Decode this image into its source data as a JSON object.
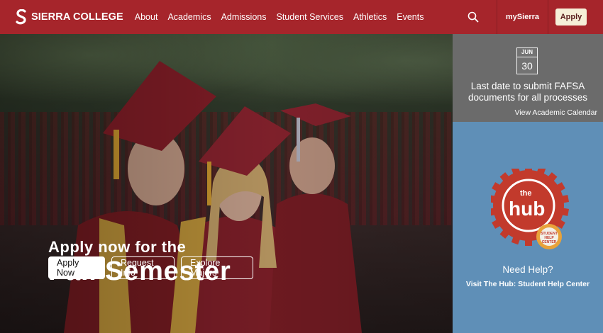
{
  "header": {
    "logo_text": "SIERRA COLLEGE",
    "nav": [
      "About",
      "Academics",
      "Admissions",
      "Student Services",
      "Athletics",
      "Events"
    ],
    "mysierra_label": "mySierra",
    "apply_label": "Apply"
  },
  "hero": {
    "line1": "Apply now for the",
    "line2": "Fall Semester",
    "buttons": {
      "apply_now": "Apply Now",
      "request_info": "Request Info",
      "explore_majors": "Explore Majors"
    }
  },
  "calendar": {
    "month": "JUN",
    "day": "30",
    "event_text": "Last date to submit FAFSA documents for all processes",
    "link": "View Academic Calendar"
  },
  "help": {
    "logo_word": "the hub",
    "logo_badge": "STUDENT HELP CENTER",
    "title": "Need Help?",
    "link": "Visit The Hub: Student Help Center"
  },
  "colors": {
    "header_bg": "#a6252b",
    "calendar_bg": "#6b6b6b",
    "help_bg": "#5f8fb7",
    "apply_btn_bg": "#f6efd8"
  },
  "icons": [
    "sierra-s-logo-icon",
    "search-icon",
    "hub-gear-logo-icon"
  ]
}
